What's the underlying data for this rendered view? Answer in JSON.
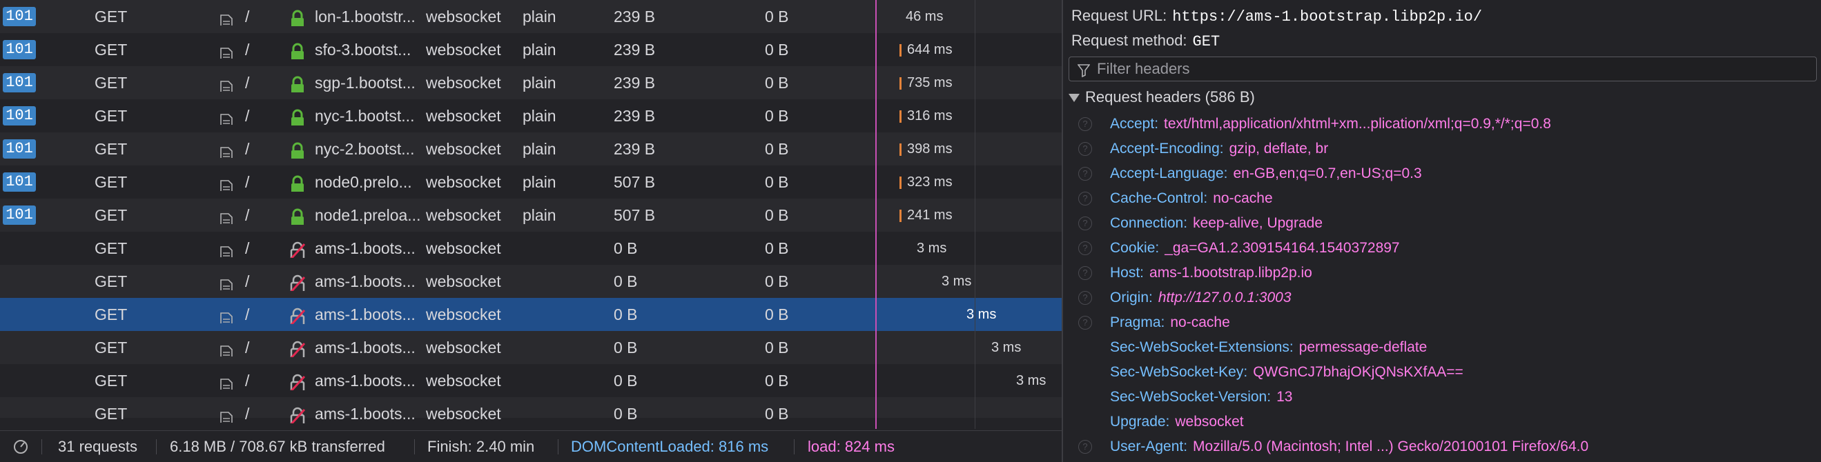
{
  "requests": [
    {
      "status": "101",
      "method": "GET",
      "file": "/",
      "secure": true,
      "domain": "lon-1.bootstr...",
      "cause": "websocket",
      "type": "plain",
      "transferred": "239 B",
      "size": "0 B",
      "timing": "46 ms",
      "bar": false,
      "timing_offset": 0
    },
    {
      "status": "101",
      "method": "GET",
      "file": "/",
      "secure": true,
      "domain": "sfo-3.bootst...",
      "cause": "websocket",
      "type": "plain",
      "transferred": "239 B",
      "size": "0 B",
      "timing": "644 ms",
      "bar": true,
      "timing_offset": 0
    },
    {
      "status": "101",
      "method": "GET",
      "file": "/",
      "secure": true,
      "domain": "sgp-1.bootst...",
      "cause": "websocket",
      "type": "plain",
      "transferred": "239 B",
      "size": "0 B",
      "timing": "735 ms",
      "bar": true,
      "timing_offset": 0
    },
    {
      "status": "101",
      "method": "GET",
      "file": "/",
      "secure": true,
      "domain": "nyc-1.bootst...",
      "cause": "websocket",
      "type": "plain",
      "transferred": "239 B",
      "size": "0 B",
      "timing": "316 ms",
      "bar": true,
      "timing_offset": 0
    },
    {
      "status": "101",
      "method": "GET",
      "file": "/",
      "secure": true,
      "domain": "nyc-2.bootst...",
      "cause": "websocket",
      "type": "plain",
      "transferred": "239 B",
      "size": "0 B",
      "timing": "398 ms",
      "bar": true,
      "timing_offset": 0
    },
    {
      "status": "101",
      "method": "GET",
      "file": "/",
      "secure": true,
      "domain": "node0.prelo...",
      "cause": "websocket",
      "type": "plain",
      "transferred": "507 B",
      "size": "0 B",
      "timing": "323 ms",
      "bar": true,
      "timing_offset": 0
    },
    {
      "status": "101",
      "method": "GET",
      "file": "/",
      "secure": true,
      "domain": "node1.preloa...",
      "cause": "websocket",
      "type": "plain",
      "transferred": "507 B",
      "size": "0 B",
      "timing": "241 ms",
      "bar": true,
      "timing_offset": 0
    },
    {
      "status": "",
      "method": "GET",
      "file": "/",
      "secure": false,
      "domain": "ams-1.boots...",
      "cause": "websocket",
      "type": "",
      "transferred": "0 B",
      "size": "0 B",
      "timing": "3 ms",
      "bar": false,
      "timing_offset": 1
    },
    {
      "status": "",
      "method": "GET",
      "file": "/",
      "secure": false,
      "domain": "ams-1.boots...",
      "cause": "websocket",
      "type": "",
      "transferred": "0 B",
      "size": "0 B",
      "timing": "3 ms",
      "bar": false,
      "timing_offset": 2
    },
    {
      "status": "",
      "method": "GET",
      "file": "/",
      "secure": false,
      "domain": "ams-1.boots...",
      "cause": "websocket",
      "type": "",
      "transferred": "0 B",
      "size": "0 B",
      "timing": "3 ms",
      "bar": false,
      "timing_offset": 3,
      "selected": true
    },
    {
      "status": "",
      "method": "GET",
      "file": "/",
      "secure": false,
      "domain": "ams-1.boots...",
      "cause": "websocket",
      "type": "",
      "transferred": "0 B",
      "size": "0 B",
      "timing": "3 ms",
      "bar": false,
      "timing_offset": 4
    },
    {
      "status": "",
      "method": "GET",
      "file": "/",
      "secure": false,
      "domain": "ams-1.boots...",
      "cause": "websocket",
      "type": "",
      "transferred": "0 B",
      "size": "0 B",
      "timing": "3 ms",
      "bar": false,
      "timing_offset": 5
    },
    {
      "status": "",
      "method": "GET",
      "file": "/",
      "secure": false,
      "domain": "ams-1.boots...",
      "cause": "websocket",
      "type": "",
      "transferred": "0 B",
      "size": "0 B",
      "timing": "",
      "bar": false,
      "timing_offset": 6,
      "partial": true
    }
  ],
  "statusbar": {
    "requests": "31 requests",
    "transferred": "6.18 MB / 708.67 kB transferred",
    "finish": "Finish: 2.40 min",
    "domcontentloaded": "DOMContentLoaded: 816 ms",
    "load": "load: 824 ms"
  },
  "details": {
    "url_label": "Request URL:",
    "url": "https://ams-1.bootstrap.libp2p.io/",
    "method_label": "Request method:",
    "method": "GET",
    "filter_placeholder": "Filter headers",
    "section_title": "Request headers (586 B)",
    "headers": [
      {
        "name": "Accept:",
        "value": "text/html,application/xhtml+xm...plication/xml;q=0.9,*/*;q=0.8",
        "help": true
      },
      {
        "name": "Accept-Encoding:",
        "value": "gzip, deflate, br",
        "help": true
      },
      {
        "name": "Accept-Language:",
        "value": "en-GB,en;q=0.7,en-US;q=0.3",
        "help": true
      },
      {
        "name": "Cache-Control:",
        "value": "no-cache",
        "help": true
      },
      {
        "name": "Connection:",
        "value": "keep-alive, Upgrade",
        "help": true
      },
      {
        "name": "Cookie:",
        "value": "_ga=GA1.2.309154164.1540372897",
        "help": true
      },
      {
        "name": "Host:",
        "value": "ams-1.bootstrap.libp2p.io",
        "help": true
      },
      {
        "name": "Origin:",
        "value": "http://127.0.0.1:3003",
        "help": true,
        "italic": true
      },
      {
        "name": "Pragma:",
        "value": "no-cache",
        "help": true
      },
      {
        "name": "Sec-WebSocket-Extensions:",
        "value": "permessage-deflate",
        "help": false
      },
      {
        "name": "Sec-WebSocket-Key:",
        "value": "QWGnCJ7bhajOKjQNsKXfAA==",
        "help": false
      },
      {
        "name": "Sec-WebSocket-Version:",
        "value": "13",
        "help": false
      },
      {
        "name": "Upgrade:",
        "value": "websocket",
        "help": false
      },
      {
        "name": "User-Agent:",
        "value": "Mozilla/5.0 (Macintosh; Intel ...) Gecko/20100101 Firefox/64.0",
        "help": true
      }
    ]
  },
  "colors": {
    "status_badge": "#3c84c7",
    "secure_lock": "#5bb53b",
    "insecure_lock": "#e22850",
    "header_name": "#75bfff",
    "header_value": "#ff7de9",
    "selected_row": "#204e8a",
    "domcontentloaded": "#75bfff",
    "load": "#ff7de9"
  }
}
